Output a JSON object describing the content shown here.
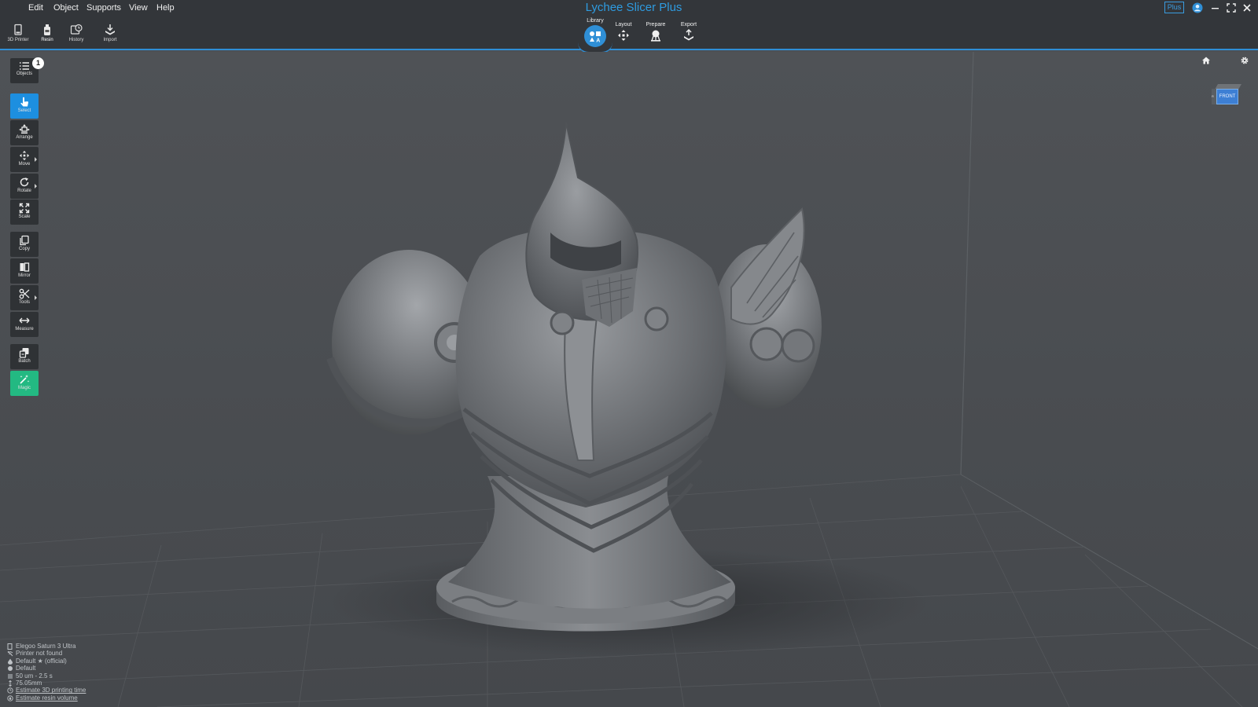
{
  "app": {
    "title": "Lychee Slicer Plus",
    "plan_badge": "Plus",
    "accent_color": "#2f8fd6"
  },
  "menu": [
    "Edit",
    "Object",
    "Supports",
    "View",
    "Help"
  ],
  "toolbar": {
    "left_buttons": [
      {
        "label": "3D Printer",
        "icon": "printer-icon"
      },
      {
        "label": "Resin",
        "icon": "resin-bottle-icon",
        "active": true
      },
      {
        "label": "History",
        "icon": "history-icon"
      },
      {
        "label": "Import",
        "icon": "import-icon"
      }
    ],
    "stages": [
      {
        "label": "Library",
        "icon": "library-icon",
        "active": true
      },
      {
        "label": "Layout",
        "icon": "layout-move-icon"
      },
      {
        "label": "Prepare",
        "icon": "prepare-supports-icon"
      },
      {
        "label": "Export",
        "icon": "export-icon"
      }
    ]
  },
  "sidebar": {
    "objects": {
      "label": "Objects",
      "count": "1"
    },
    "tools": [
      {
        "label": "Select",
        "icon": "pointer-icon",
        "state": "selected"
      },
      {
        "label": "Arrange",
        "icon": "arrange-icon"
      },
      {
        "label": "Move",
        "icon": "move-icon",
        "submenu": true
      },
      {
        "label": "Rotate",
        "icon": "rotate-icon",
        "submenu": true
      },
      {
        "label": "Scale",
        "icon": "scale-icon"
      },
      {
        "label": "Copy",
        "icon": "copy-icon"
      },
      {
        "label": "Mirror",
        "icon": "mirror-icon"
      },
      {
        "label": "Tools",
        "icon": "scissors-icon",
        "submenu": true
      },
      {
        "label": "Measure",
        "icon": "measure-icon"
      },
      {
        "label": "Batch",
        "icon": "batch-icon"
      },
      {
        "label": "Magic",
        "icon": "magic-wand-icon",
        "state": "magic"
      }
    ],
    "magic_color": "#23b982",
    "selected_color": "#1d8fe0"
  },
  "viewport": {
    "view_cube_face": "FRONT",
    "view_cube_side": "R",
    "model": "armored-knight-bust"
  },
  "status": {
    "printer": "Elegoo Saturn 3 Ultra",
    "connection": "Printer not found",
    "resin_profile": "Default ★ (official)",
    "support_profile": "Default",
    "layer": "50 um - 2.5 s",
    "height": "75.05mm",
    "estimate_time": "Estimate 3D printing time",
    "estimate_resin": "Estimate resin volume"
  }
}
